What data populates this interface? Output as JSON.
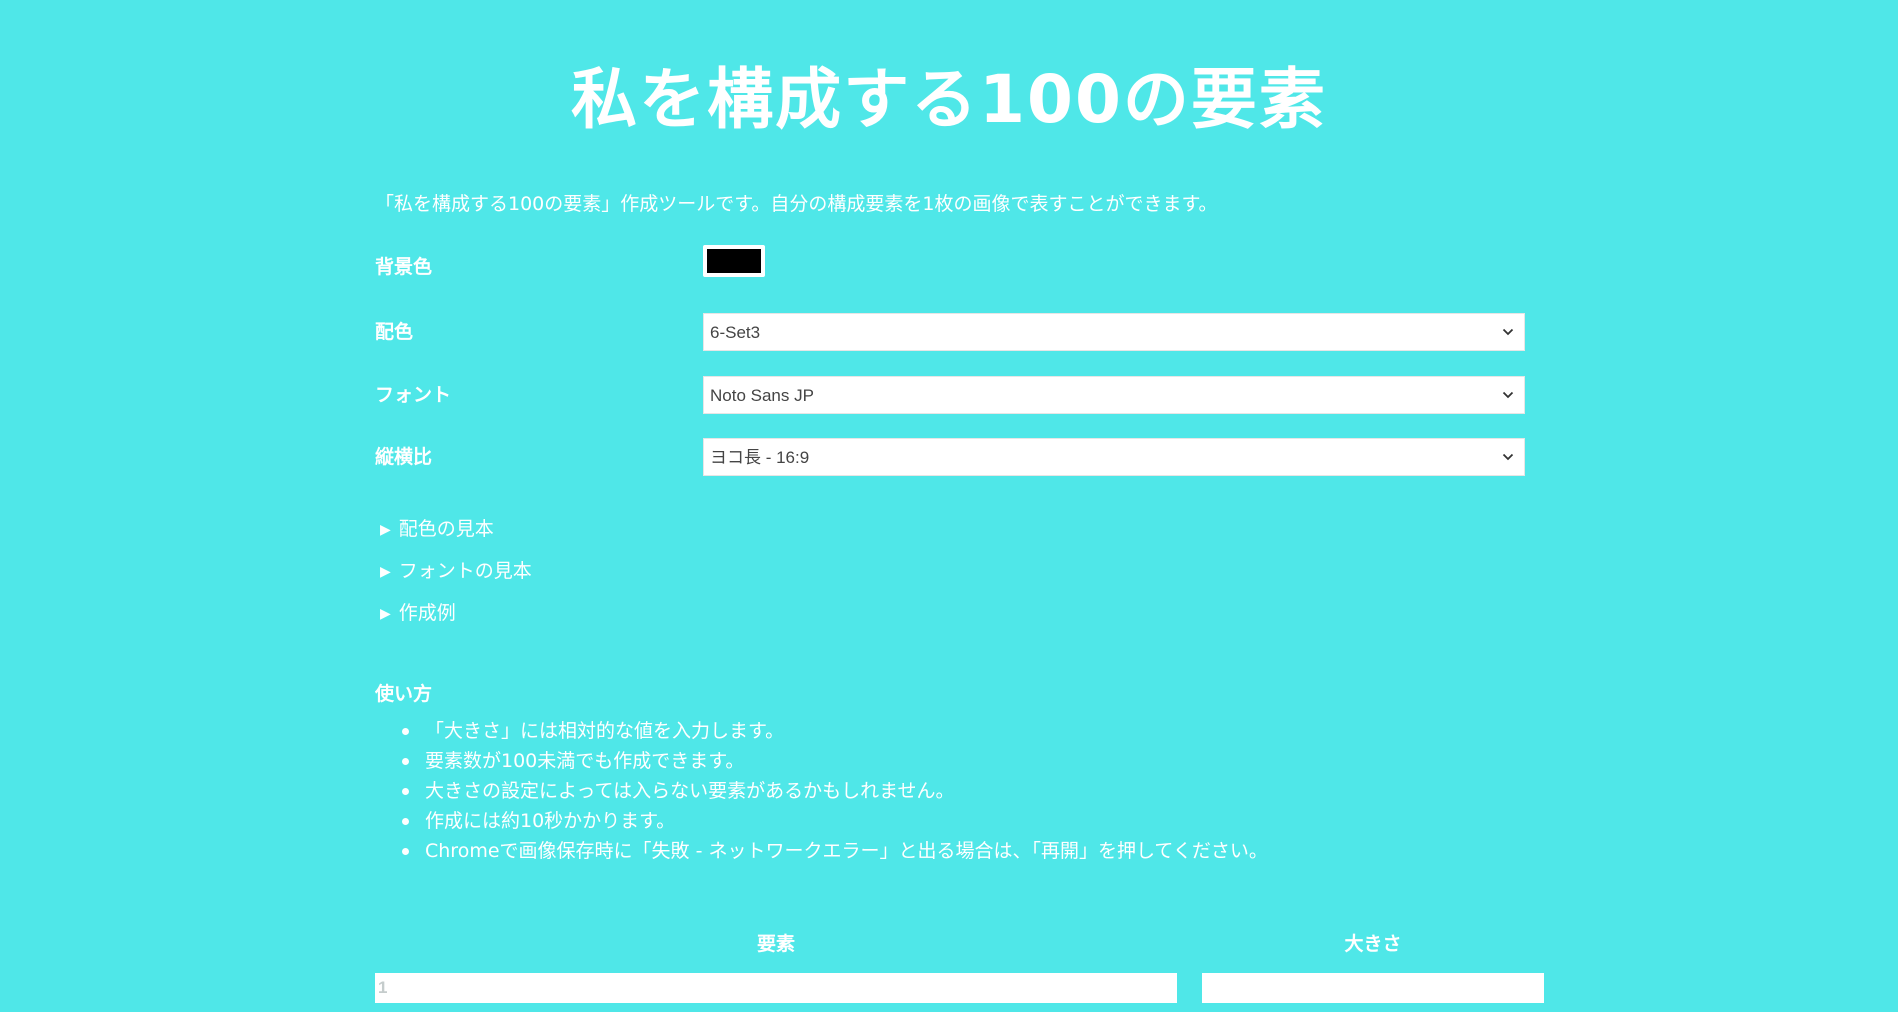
{
  "page": {
    "title": "私を構成する100の要素",
    "intro": "「私を構成する100の要素」作成ツールです。自分の構成要素を1枚の画像で表すことができます。"
  },
  "settings": {
    "background_color": {
      "label": "背景色",
      "value": "#000000"
    },
    "color_scheme": {
      "label": "配色",
      "value": "6-Set3"
    },
    "font": {
      "label": "フォント",
      "value": "Noto Sans JP"
    },
    "aspect_ratio": {
      "label": "縦横比",
      "value": "ヨコ長 - 16:9"
    }
  },
  "details": [
    {
      "label": "配色の見本"
    },
    {
      "label": "フォントの見本"
    },
    {
      "label": "作成例"
    }
  ],
  "usage": {
    "heading": "使い方",
    "items": [
      "「大きさ」には相対的な値を入力します。",
      "要素数が100未満でも作成できます。",
      "大きさの設定によっては入らない要素があるかもしれません。",
      "作成には約10秒かかります。",
      "Chromeで画像保存時に「失敗 - ネットワークエラー」と出る場合は、「再開」を押してください。"
    ]
  },
  "table": {
    "headers": {
      "element": "要素",
      "size": "大きさ"
    },
    "rows": [
      {
        "element_placeholder": "1",
        "size_placeholder": ""
      }
    ]
  },
  "colors": {
    "background": "#4fe7e8",
    "text": "#ffffff",
    "input_background": "#ffffff",
    "select_text": "#444444"
  },
  "icons": {
    "select_arrow": "chevron-down-icon",
    "details_marker": "triangle-right-icon"
  }
}
